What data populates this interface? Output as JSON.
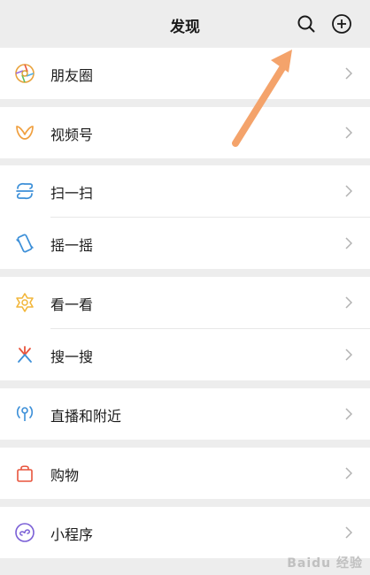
{
  "header": {
    "title": "发现"
  },
  "menu": {
    "moments": "朋友圈",
    "channels": "视频号",
    "scan": "扫一扫",
    "shake": "摇一摇",
    "top_stories": "看一看",
    "search": "搜一搜",
    "live_nearby": "直播和附近",
    "shopping": "购物",
    "mini_programs": "小程序"
  },
  "annotation_color": "#f4a36b",
  "watermark": "Baidu 经验"
}
